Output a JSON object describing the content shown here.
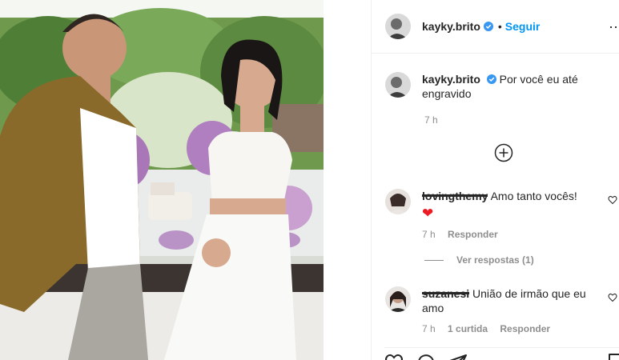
{
  "post": {
    "author": "kayky.brito",
    "follow_label": "Seguir",
    "separator": "•"
  },
  "caption": {
    "username": "kayky.brito",
    "text": "Por você eu até engravido",
    "time": "7 h"
  },
  "comments": [
    {
      "username": "",
      "text": "Amo tanto vocês!",
      "emoji": "❤",
      "time": "7 h",
      "reply_label": "Responder",
      "view_replies": "Ver respostas (1)"
    },
    {
      "username": "suzanesi",
      "text": "União de irmão que eu amo",
      "time": "7 h",
      "likes": "1 curtida",
      "reply_label": "Responder"
    }
  ],
  "colors": {
    "link": "#0095f6",
    "muted": "#8e8e8e",
    "text": "#262626",
    "verified": "#3897f0"
  },
  "icons": [
    "verified-icon",
    "more-icon",
    "plus-circle-icon",
    "heart-icon",
    "comment-icon",
    "share-icon",
    "bookmark-icon"
  ]
}
